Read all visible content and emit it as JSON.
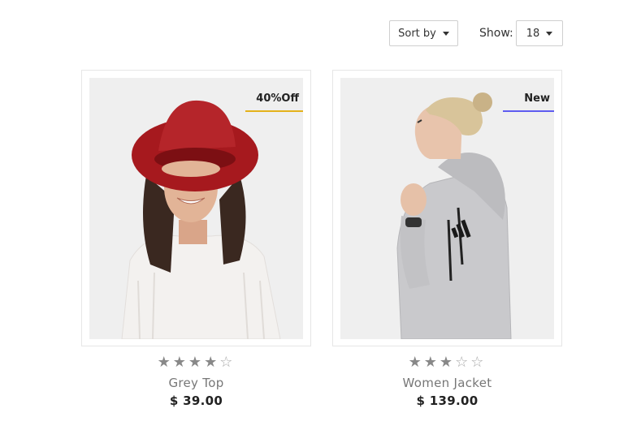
{
  "toolbar": {
    "sort_label": "Sort by",
    "show_label": "Show:",
    "show_value": "18"
  },
  "products": [
    {
      "badge": "40%Off",
      "badge_color": "#e4b21a",
      "name": "Grey Top",
      "price": "$ 39.00",
      "rating": 4,
      "rating_max": 5
    },
    {
      "badge": "New",
      "badge_color": "#5e5cf0",
      "name": "Women Jacket",
      "price": "$ 139.00",
      "rating": 3,
      "rating_max": 5
    }
  ]
}
